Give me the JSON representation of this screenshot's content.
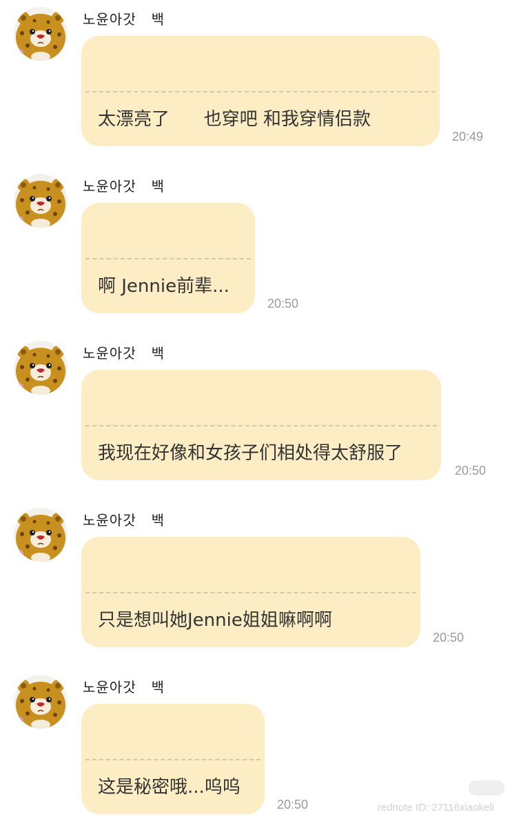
{
  "messages": [
    {
      "sender": "노윤아갓   백",
      "text": "太漂亮了      也穿吧 和我穿情侣款",
      "time": "20:49"
    },
    {
      "sender": "노윤아갓   백",
      "text": "啊 Jennie前辈...",
      "time": "20:50"
    },
    {
      "sender": "노윤아갓   백",
      "text": "我现在好像和女孩子们相处得太舒服了",
      "time": "20:50"
    },
    {
      "sender": "노윤아갓   백",
      "text": "只是想叫她Jennie姐姐嘛啊啊",
      "time": "20:50"
    },
    {
      "sender": "노윤아갓   백",
      "text": "这是秘密哦...呜呜",
      "time": "20:50"
    }
  ],
  "avatar_icon": "teddy-bear-avatar-icon",
  "colors": {
    "bubble": "#fdedc5",
    "dash": "#d9c7a3",
    "text": "#333333",
    "time": "#9a9a9a"
  },
  "watermark": "rednote ID: 27116xiaokeli"
}
